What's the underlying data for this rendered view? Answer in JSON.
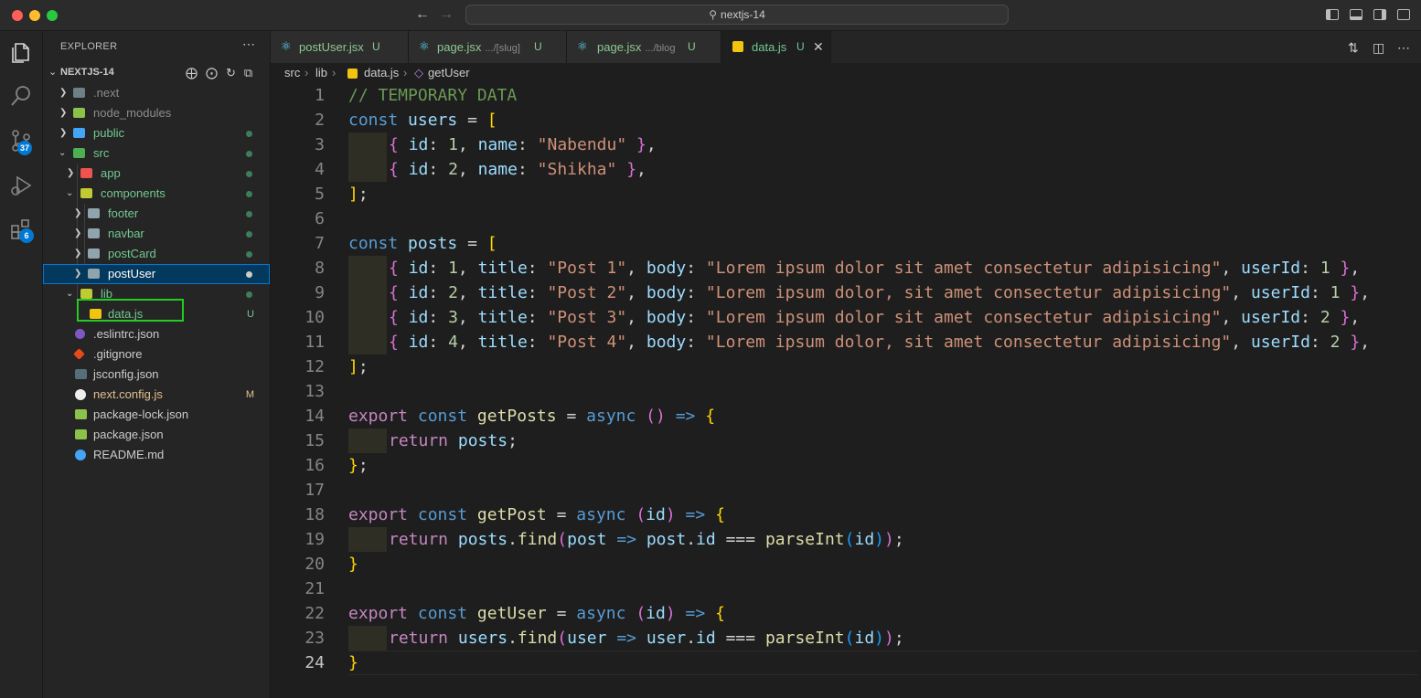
{
  "window": {
    "title": "nextjs-14"
  },
  "activity": {
    "scm_badge": "37",
    "ext_badge": "6"
  },
  "explorer": {
    "title": "EXPLORER",
    "root": "NEXTJS-14",
    "items": [
      {
        "label": ".next",
        "status": ""
      },
      {
        "label": "node_modules",
        "status": ""
      },
      {
        "label": "public",
        "status": "dot"
      },
      {
        "label": "src",
        "status": "dot"
      },
      {
        "label": "app",
        "status": "dot"
      },
      {
        "label": "components",
        "status": "dot"
      },
      {
        "label": "footer",
        "status": "dot"
      },
      {
        "label": "navbar",
        "status": "dot"
      },
      {
        "label": "postCard",
        "status": "dot"
      },
      {
        "label": "postUser",
        "status": "dot"
      },
      {
        "label": "lib",
        "status": "dot"
      },
      {
        "label": "data.js",
        "status": "U"
      },
      {
        "label": ".eslintrc.json",
        "status": ""
      },
      {
        "label": ".gitignore",
        "status": ""
      },
      {
        "label": "jsconfig.json",
        "status": ""
      },
      {
        "label": "next.config.js",
        "status": "M"
      },
      {
        "label": "package-lock.json",
        "status": ""
      },
      {
        "label": "package.json",
        "status": ""
      },
      {
        "label": "README.md",
        "status": ""
      }
    ]
  },
  "tabs": [
    {
      "label": "postUser.jsx",
      "desc": "",
      "status": "U"
    },
    {
      "label": "page.jsx",
      "desc": ".../[slug]",
      "status": "U"
    },
    {
      "label": "page.jsx",
      "desc": ".../blog",
      "status": "U"
    },
    {
      "label": "data.js",
      "desc": "",
      "status": "U"
    }
  ],
  "breadcrumb": [
    "src",
    "lib",
    "data.js",
    "getUser"
  ],
  "code": {
    "line_numbers": [
      "1",
      "2",
      "3",
      "4",
      "5",
      "6",
      "7",
      "8",
      "9",
      "10",
      "11",
      "12",
      "13",
      "14",
      "15",
      "16",
      "17",
      "18",
      "19",
      "20",
      "21",
      "22",
      "23",
      "24"
    ],
    "comment": "// TEMPORARY DATA",
    "users": [
      {
        "id": "1",
        "name": "\"Nabendu\""
      },
      {
        "id": "2",
        "name": "\"Shikha\""
      }
    ],
    "posts": [
      {
        "id": "1",
        "title": "\"Post 1\"",
        "body": "\"Lorem ipsum dolor sit amet consectetur adipisicing\"",
        "userId": "1"
      },
      {
        "id": "2",
        "title": "\"Post 2\"",
        "body": "\"Lorem ipsum dolor, sit amet consectetur adipisicing\"",
        "userId": "1"
      },
      {
        "id": "3",
        "title": "\"Post 3\"",
        "body": "\"Lorem ipsum dolor sit amet consectetur adipisicing\"",
        "userId": "2"
      },
      {
        "id": "4",
        "title": "\"Post 4\"",
        "body": "\"Lorem ipsum dolor, sit amet consectetur adipisicing\"",
        "userId": "2"
      }
    ]
  }
}
